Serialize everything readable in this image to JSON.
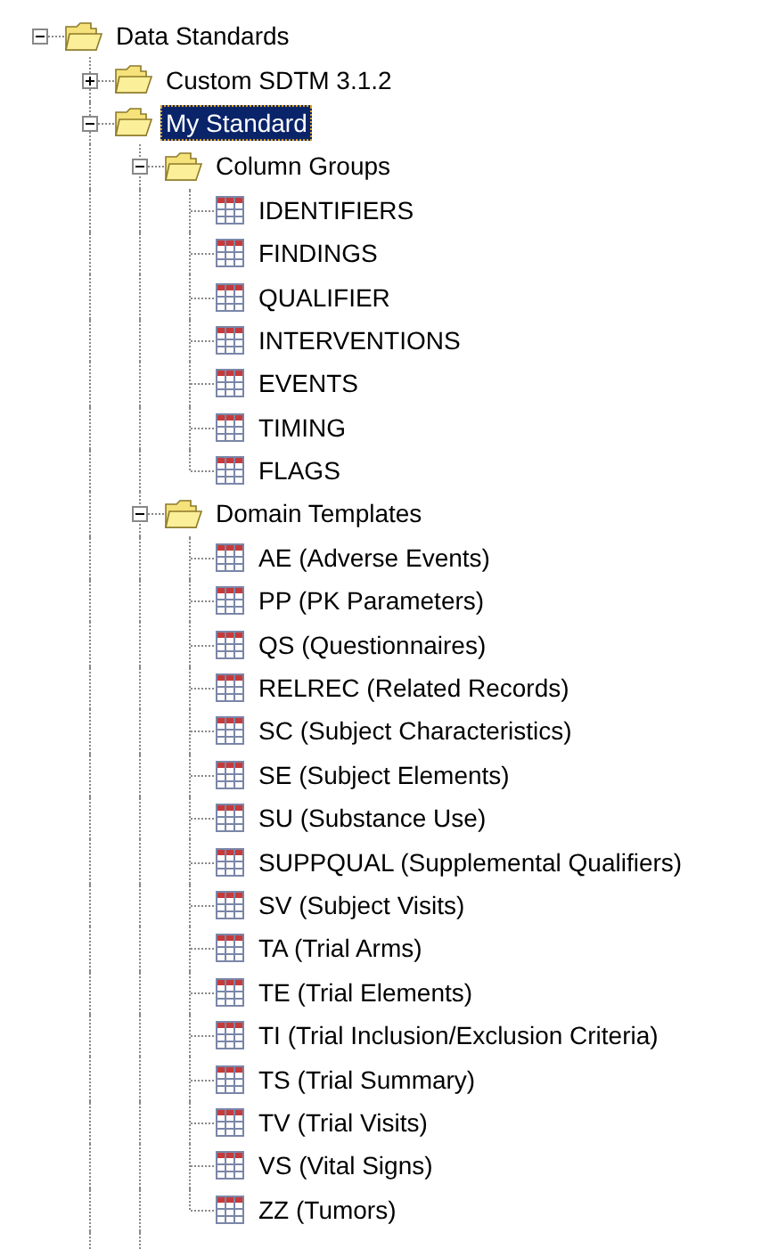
{
  "tree": [
    {
      "label": "Data Standards",
      "kind": "folder",
      "expanded": true,
      "selected": false,
      "children": [
        {
          "label": "Custom SDTM 3.1.2",
          "kind": "folder",
          "expanded": false,
          "selected": false
        },
        {
          "label": "My Standard",
          "kind": "folder",
          "expanded": true,
          "selected": true,
          "more_below": true,
          "children": [
            {
              "label": "Column Groups",
              "kind": "folder",
              "expanded": true,
              "selected": false,
              "children": [
                {
                  "label": "IDENTIFIERS",
                  "kind": "table",
                  "selected": false
                },
                {
                  "label": "FINDINGS",
                  "kind": "table",
                  "selected": false
                },
                {
                  "label": "QUALIFIER",
                  "kind": "table",
                  "selected": false
                },
                {
                  "label": "INTERVENTIONS",
                  "kind": "table",
                  "selected": false
                },
                {
                  "label": "EVENTS",
                  "kind": "table",
                  "selected": false
                },
                {
                  "label": "TIMING",
                  "kind": "table",
                  "selected": false
                },
                {
                  "label": "FLAGS",
                  "kind": "table",
                  "selected": false
                }
              ]
            },
            {
              "label": "Domain Templates",
              "kind": "folder",
              "expanded": true,
              "selected": false,
              "more_below": true,
              "children": [
                {
                  "label": "AE (Adverse Events)",
                  "kind": "table",
                  "selected": false
                },
                {
                  "label": "PP (PK Parameters)",
                  "kind": "table",
                  "selected": false
                },
                {
                  "label": "QS (Questionnaires)",
                  "kind": "table",
                  "selected": false
                },
                {
                  "label": "RELREC (Related Records)",
                  "kind": "table",
                  "selected": false
                },
                {
                  "label": "SC (Subject Characteristics)",
                  "kind": "table",
                  "selected": false
                },
                {
                  "label": "SE (Subject Elements)",
                  "kind": "table",
                  "selected": false
                },
                {
                  "label": "SU (Substance Use)",
                  "kind": "table",
                  "selected": false
                },
                {
                  "label": "SUPPQUAL (Supplemental Qualifiers)",
                  "kind": "table",
                  "selected": false
                },
                {
                  "label": "SV (Subject Visits)",
                  "kind": "table",
                  "selected": false
                },
                {
                  "label": "TA (Trial Arms)",
                  "kind": "table",
                  "selected": false
                },
                {
                  "label": "TE (Trial Elements)",
                  "kind": "table",
                  "selected": false
                },
                {
                  "label": "TI (Trial Inclusion/Exclusion Criteria)",
                  "kind": "table",
                  "selected": false
                },
                {
                  "label": "TS (Trial Summary)",
                  "kind": "table",
                  "selected": false
                },
                {
                  "label": "TV (Trial Visits)",
                  "kind": "table",
                  "selected": false
                },
                {
                  "label": "VS (Vital Signs)",
                  "kind": "table",
                  "selected": false
                },
                {
                  "label": "ZZ (Tumors)",
                  "kind": "table",
                  "selected": false
                }
              ]
            }
          ]
        }
      ]
    }
  ]
}
